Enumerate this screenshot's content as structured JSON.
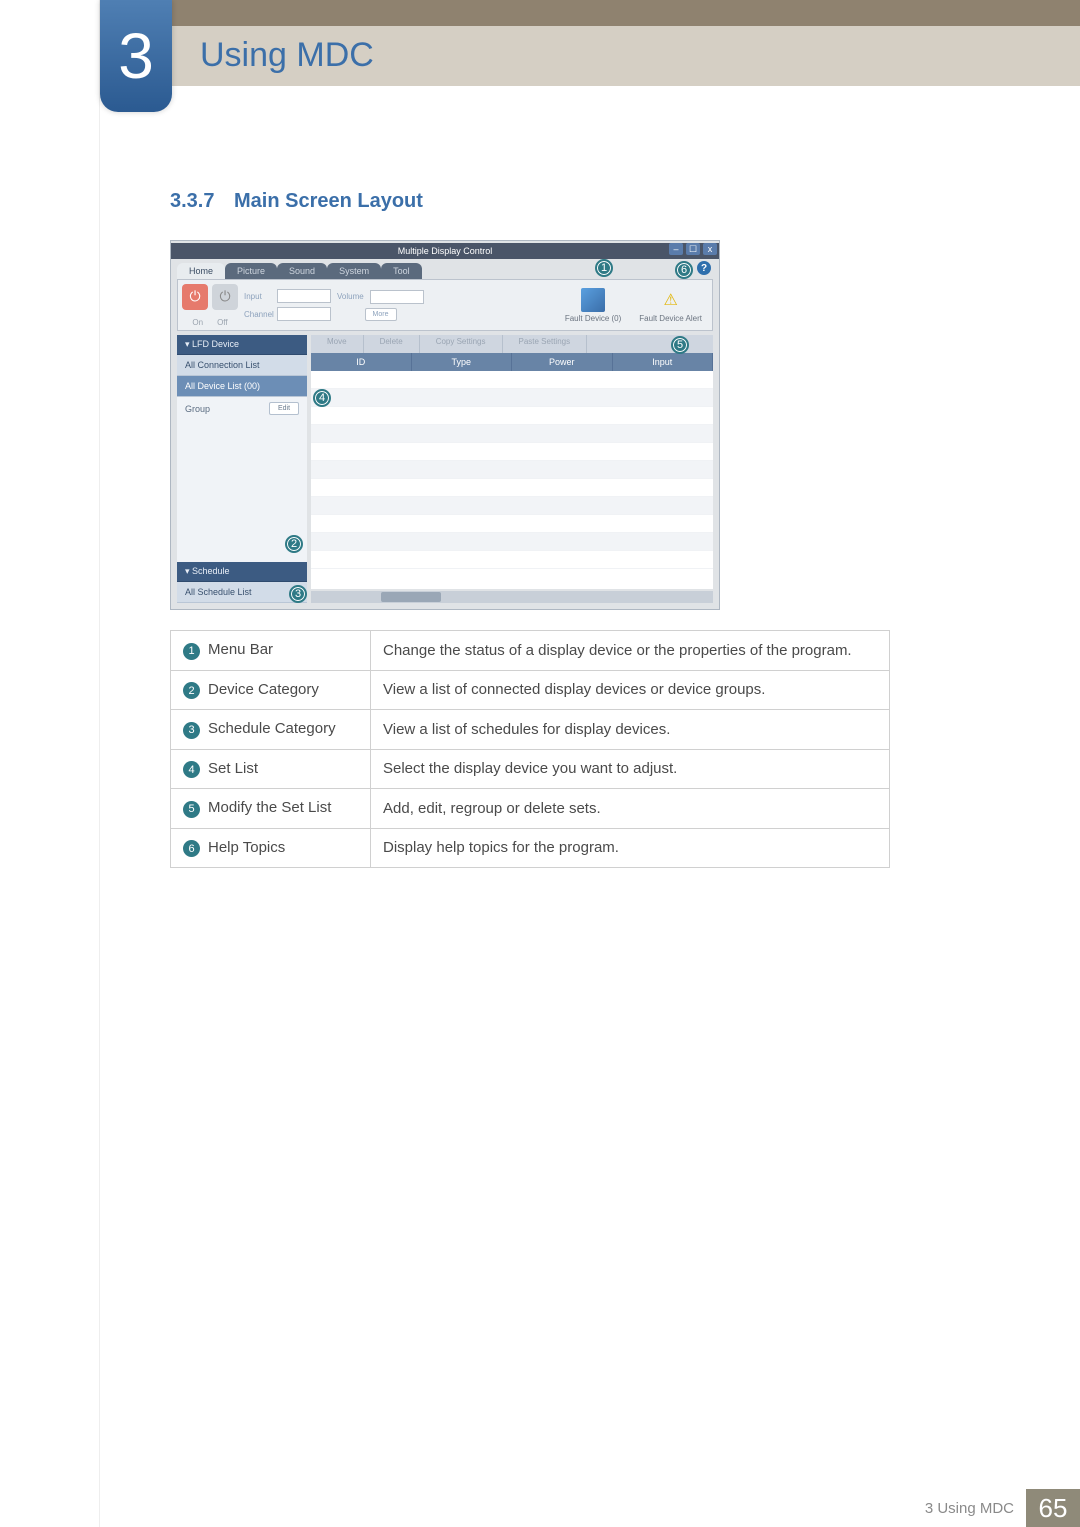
{
  "header": {
    "chapter_number": "3",
    "chapter_title": "Using MDC",
    "section_number": "3.3.7",
    "section_title": "Main Screen Layout"
  },
  "screenshot": {
    "window_title": "Multiple Display Control",
    "window_controls": {
      "min": "–",
      "max": "☐",
      "close": "x"
    },
    "tabs": [
      "Home",
      "Picture",
      "Sound",
      "System",
      "Tool"
    ],
    "help_icon": "?",
    "toolbar": {
      "power_on_label": "On",
      "power_off_label": "Off",
      "input_label": "Input",
      "channel_label": "Channel",
      "volume_label": "Volume",
      "more_button": "More",
      "fault_device_count": "Fault Device (0)",
      "fault_device_alert": "Fault Device Alert"
    },
    "sidebar": {
      "lfd_header": "▾  LFD Device",
      "all_connection": "All Connection List",
      "all_device": "All Device List (00)",
      "group_label": "Group",
      "edit_button": "Edit",
      "schedule_header": "▾  Schedule",
      "all_schedule": "All Schedule List"
    },
    "setlist_actions": [
      "Move",
      "Delete",
      "Copy Settings",
      "Paste Settings"
    ],
    "grid_columns": [
      "ID",
      "Type",
      "Power",
      "Input"
    ]
  },
  "callouts": {
    "1": "1",
    "2": "2",
    "3": "3",
    "4": "4",
    "5": "5",
    "6": "6"
  },
  "legend": [
    {
      "n": "1",
      "name": "Menu Bar",
      "desc": "Change the status of a display device or the properties of the program."
    },
    {
      "n": "2",
      "name": "Device Category",
      "desc": "View a list of connected display devices or device groups."
    },
    {
      "n": "3",
      "name": "Schedule Category",
      "desc": "View a list of schedules for display devices."
    },
    {
      "n": "4",
      "name": "Set List",
      "desc": "Select the display device you want to adjust."
    },
    {
      "n": "5",
      "name": "Modify the Set List",
      "desc": "Add, edit, regroup or delete sets."
    },
    {
      "n": "6",
      "name": "Help Topics",
      "desc": "Display help topics for the program."
    }
  ],
  "footer": {
    "label": "3 Using MDC",
    "page_number": "65"
  }
}
